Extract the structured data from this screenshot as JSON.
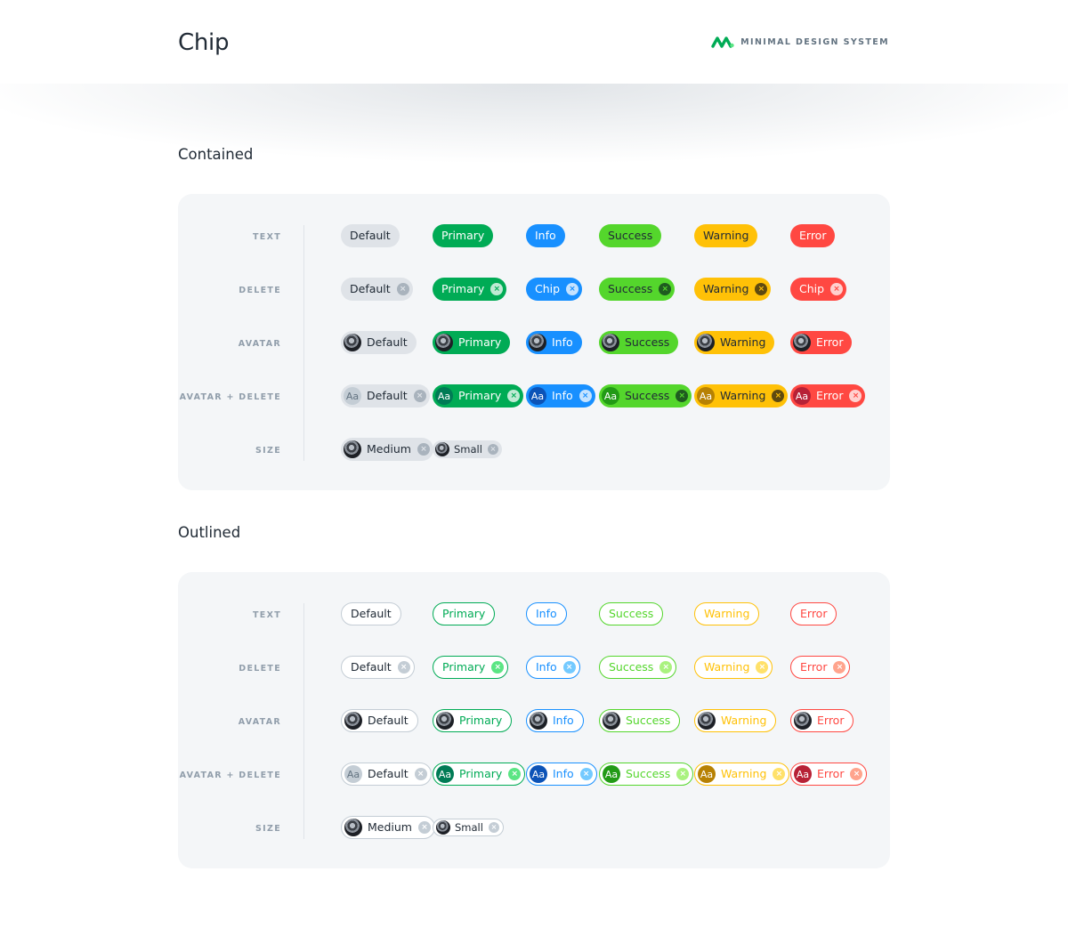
{
  "header": {
    "title": "Chip",
    "brand": "MINIMAL DESIGN SYSTEM",
    "brand_color": "#00ab55"
  },
  "sections": [
    {
      "title": "Contained",
      "variant": "contained",
      "row_labels": {
        "text": "TEXT",
        "delete": "DELETE",
        "avatar": "AVATAR",
        "avatar_delete": "AVATAR + DELETE",
        "size": "SIZE"
      },
      "text_row": [
        "Default",
        "Primary",
        "Info",
        "Success",
        "Warning",
        "Error"
      ],
      "delete_row": [
        "Default",
        "Primary",
        "Chip",
        "Success",
        "Warning",
        "Chip"
      ],
      "avatar_row": [
        "Default",
        "Primary",
        "Info",
        "Success",
        "Warning",
        "Error"
      ],
      "avatar_delete_row": [
        "Default",
        "Primary",
        "Info",
        "Success",
        "Warning",
        "Error"
      ],
      "avatar_letters": "Aa",
      "size_row": [
        "Medium",
        "Small"
      ]
    },
    {
      "title": "Outlined",
      "variant": "outlined",
      "row_labels": {
        "text": "TEXT",
        "delete": "DELETE",
        "avatar": "AVATAR",
        "avatar_delete": "AVATAR + DELETE",
        "size": "SIZE"
      },
      "text_row": [
        "Default",
        "Primary",
        "Info",
        "Success",
        "Warning",
        "Error"
      ],
      "delete_row": [
        "Default",
        "Primary",
        "Info",
        "Success",
        "Warning",
        "Error"
      ],
      "avatar_row": [
        "Default",
        "Primary",
        "Info",
        "Success",
        "Warning",
        "Error"
      ],
      "avatar_delete_row": [
        "Default",
        "Primary",
        "Info",
        "Success",
        "Warning",
        "Error"
      ],
      "avatar_letters": "Aa",
      "size_row": [
        "Medium",
        "Small"
      ]
    }
  ],
  "colors": {
    "default": "#dfe3e8",
    "primary": "#00ab55",
    "info": "#1890ff",
    "success": "#54d62c",
    "warning": "#ffc107",
    "error": "#ff4842"
  },
  "icons": {
    "delete": "close-circle-icon",
    "avatar": "avatar-photo",
    "logo": "minimal-logo-icon"
  }
}
